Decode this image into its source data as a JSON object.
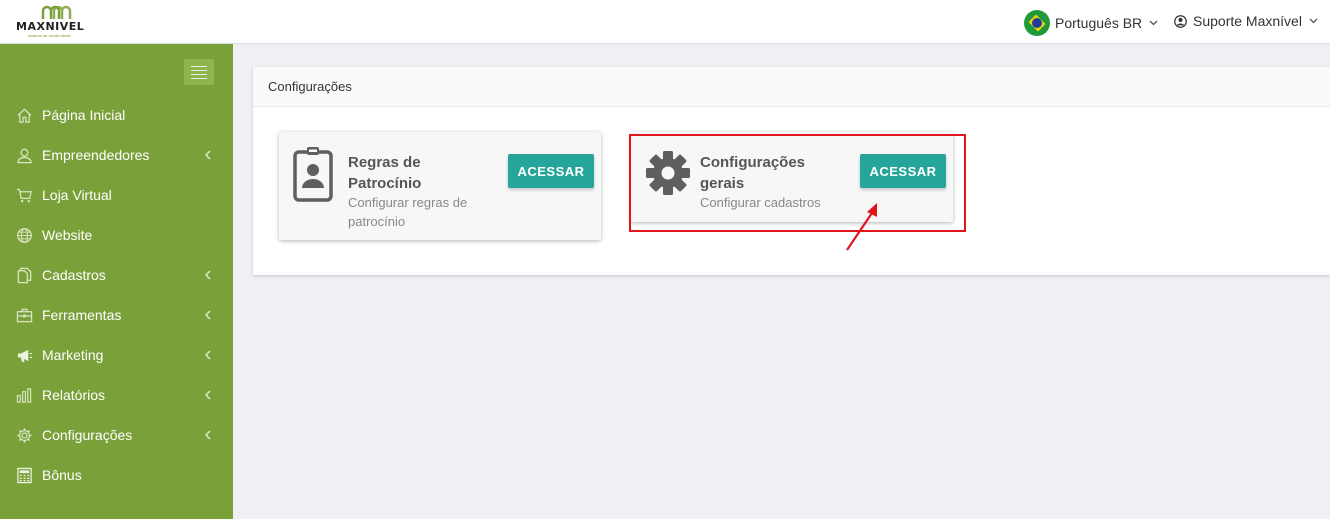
{
  "header": {
    "logo_text": "MAXNIVEL",
    "logo_tagline": "sistema de venda direta",
    "language_label": "Português BR",
    "user_label": "Suporte Maxnível"
  },
  "sidebar": {
    "items": [
      {
        "label": "Página Inicial",
        "icon": "home-icon",
        "has_submenu": false
      },
      {
        "label": "Empreendedores",
        "icon": "user-icon",
        "has_submenu": true
      },
      {
        "label": "Loja Virtual",
        "icon": "cart-icon",
        "has_submenu": false
      },
      {
        "label": "Website",
        "icon": "globe-icon",
        "has_submenu": false
      },
      {
        "label": "Cadastros",
        "icon": "documents-icon",
        "has_submenu": true
      },
      {
        "label": "Ferramentas",
        "icon": "toolbox-icon",
        "has_submenu": true
      },
      {
        "label": "Marketing",
        "icon": "megaphone-icon",
        "has_submenu": true
      },
      {
        "label": "Relatórios",
        "icon": "bar-chart-icon",
        "has_submenu": true
      },
      {
        "label": "Configurações",
        "icon": "gear-icon",
        "has_submenu": true
      },
      {
        "label": "Bônus",
        "icon": "calculator-icon",
        "has_submenu": false
      }
    ]
  },
  "main": {
    "panel_title": "Configurações",
    "cards": [
      {
        "title": "Regras de Patrocínio",
        "description": "Configurar regras de patrocínio",
        "button_label": "ACESSAR",
        "icon": "id-badge-icon"
      },
      {
        "title": "Configurações gerais",
        "description": "Configurar cadastros",
        "button_label": "ACESSAR",
        "icon": "gear-icon"
      }
    ]
  },
  "colors": {
    "sidebar": "#7aa03a",
    "button": "#26a69a",
    "highlight": "#e0161d"
  }
}
